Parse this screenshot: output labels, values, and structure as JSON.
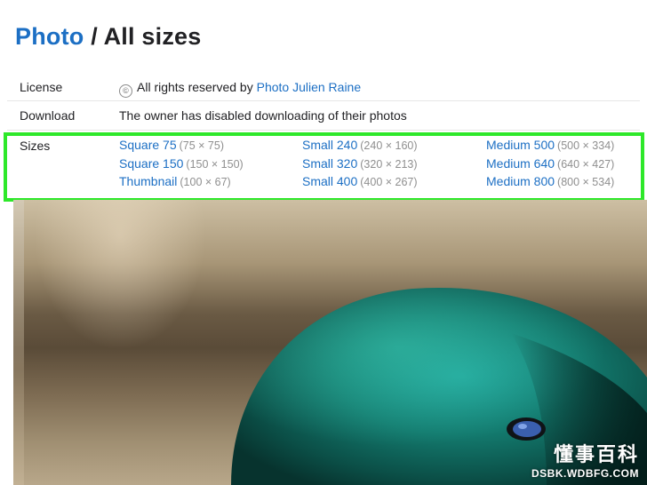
{
  "header": {
    "breadcrumb_link": "Photo",
    "separator": "/",
    "current": "All sizes"
  },
  "license": {
    "label": "License",
    "icon": "copyright-icon",
    "text": "All rights reserved by",
    "owner": "Photo Julien Raine"
  },
  "download": {
    "label": "Download",
    "text": "The owner has disabled downloading of their photos"
  },
  "sizes": {
    "label": "Sizes",
    "highlight_color": "#2ee82a",
    "columns": [
      [
        {
          "name": "Square 75",
          "dims": "(75 × 75)"
        },
        {
          "name": "Square 150",
          "dims": "(150 × 150)"
        },
        {
          "name": "Thumbnail",
          "dims": "(100 × 67)"
        }
      ],
      [
        {
          "name": "Small 240",
          "dims": "(240 × 160)"
        },
        {
          "name": "Small 320",
          "dims": "(320 × 213)"
        },
        {
          "name": "Small 400",
          "dims": "(400 × 267)"
        }
      ],
      [
        {
          "name": "Medium 500",
          "dims": "(500 × 334)"
        },
        {
          "name": "Medium 640",
          "dims": "(640 × 427)"
        },
        {
          "name": "Medium 800",
          "dims": "(800 × 534)"
        }
      ]
    ]
  },
  "watermark": {
    "main": "懂事百科",
    "sub": "DSBK.WDBFG.COM"
  },
  "colors": {
    "link": "#1c6fc4",
    "text": "#212124",
    "muted": "#8f8f8f"
  }
}
